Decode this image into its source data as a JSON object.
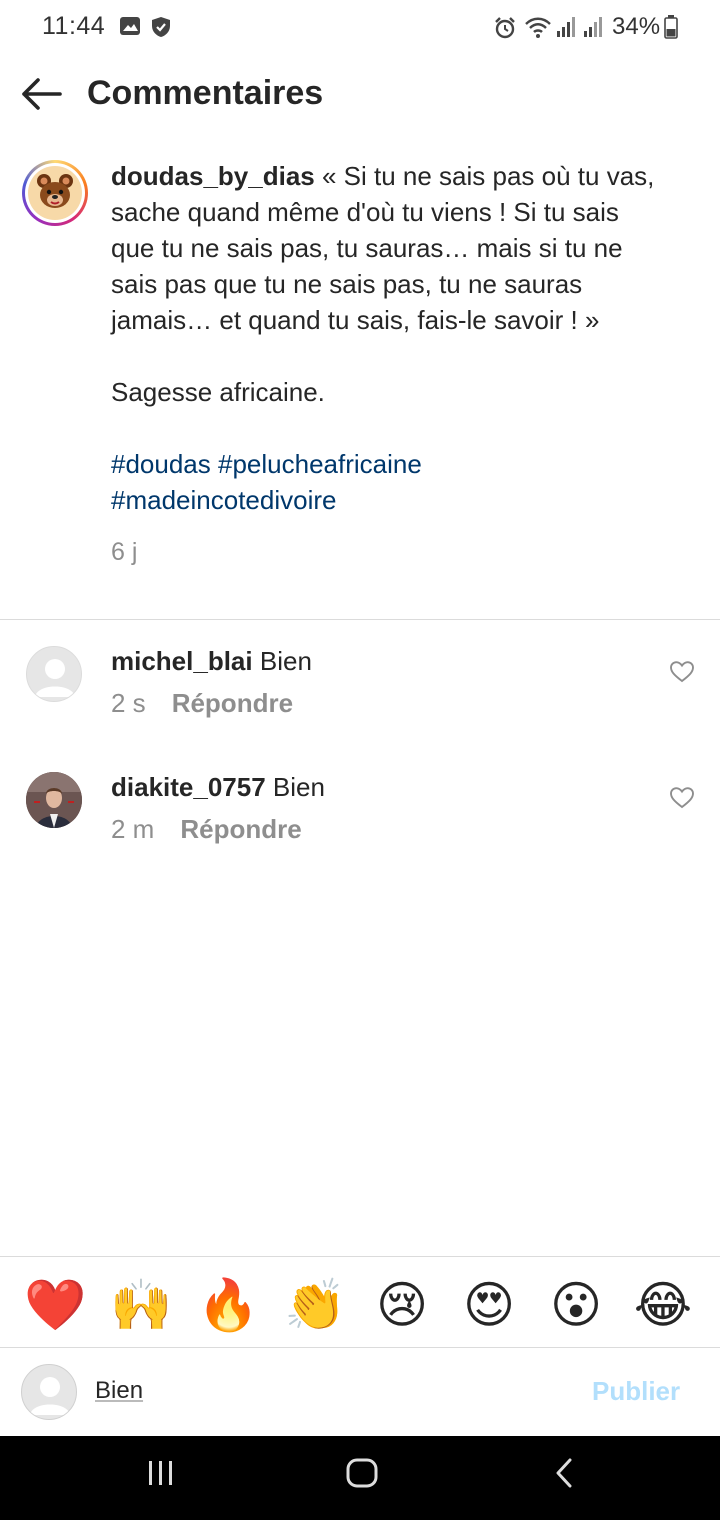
{
  "status_bar": {
    "time": "11:44",
    "battery": "34%",
    "icons": [
      "image-icon",
      "shield-icon",
      "alarm-icon",
      "wifi-icon",
      "signal-icon",
      "signal-icon",
      "battery-icon"
    ]
  },
  "header": {
    "title": "Commentaires",
    "back_icon": "arrow-left-icon"
  },
  "caption": {
    "username": "doudas_by_dias",
    "text": " « Si tu ne sais pas où tu vas, sache quand même d'où tu viens ! Si tu sais que tu ne sais pas, tu sauras… mais si tu ne sais pas que tu ne sais pas, tu ne sauras jamais… et quand tu sais, fais-le savoir ! »",
    "paragraph": "Sagesse africaine.",
    "hashtags": [
      "#doudas",
      "#pelucheafricaine",
      "#madeincotedivoire"
    ],
    "time": "6 j"
  },
  "comments": [
    {
      "username": "michel_blai",
      "text": "Bien",
      "time": "2 s",
      "reply_label": "Répondre",
      "avatar": "default-avatar"
    },
    {
      "username": "diakite_0757",
      "text": "Bien",
      "time": "2 m",
      "reply_label": "Répondre",
      "avatar": "photo-avatar"
    }
  ],
  "emoji_bar": [
    "❤️",
    "🙌",
    "🔥",
    "👏",
    "😢",
    "😍",
    "😮",
    "😂"
  ],
  "composer": {
    "value": "Bien",
    "publish_label": "Publier"
  },
  "colors": {
    "hashtag": "#00376b",
    "secondary_text": "#8e8e8e",
    "publish_disabled": "#b2dffc",
    "divider": "#dbdbdb"
  }
}
